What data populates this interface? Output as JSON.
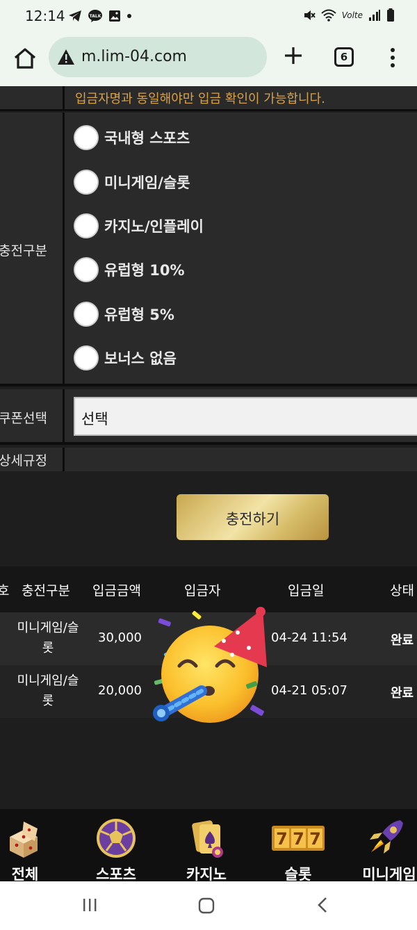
{
  "status_bar": {
    "time": "12:14",
    "notification_icons": [
      "telegram-icon",
      "kakaotalk-icon",
      "gallery-icon",
      "dot-icon"
    ],
    "system_icons": [
      "mute-icon",
      "wifi-icon",
      "volte-icon",
      "signal-icon",
      "battery-icon"
    ],
    "volte_text": "Volte"
  },
  "browser": {
    "url": "m.lim-04.com",
    "tab_count": "6"
  },
  "form": {
    "notice_text": "입금자명과 동일해야만 입금 확인이 가능합니다.",
    "charge_type_label": "충전구분",
    "charge_options": [
      "국내형 스포츠",
      "미니게임/슬롯",
      "카지노/인플레이",
      "유럽형 10%",
      "유럽형 5%",
      "보너스 없음"
    ],
    "coupon_label": "쿠폰선택",
    "coupon_value": "선택",
    "rules_label": "상세규정",
    "submit_label": "충전하기"
  },
  "history_table": {
    "columns": [
      "호",
      "충전구분",
      "입금금액",
      "입금자",
      "입금일",
      "상태"
    ],
    "rows": [
      {
        "type": "미니게임/슬롯",
        "amount": "30,000",
        "depositor": "",
        "date": "04-24 11:54",
        "status": "완료"
      },
      {
        "type": "미니게임/슬롯",
        "amount": "20,000",
        "depositor": "",
        "date": "04-21 05:07",
        "status": "완료"
      }
    ]
  },
  "overlay": {
    "emoji": "party-face-emoji"
  },
  "bottom_nav": {
    "items": [
      {
        "label": "전체",
        "icon": "dice-icon"
      },
      {
        "label": "스포츠",
        "icon": "soccer-ball-icon"
      },
      {
        "label": "카지노",
        "icon": "cards-icon"
      },
      {
        "label": "슬롯",
        "icon": "slot-777-icon"
      },
      {
        "label": "미니게임",
        "icon": "rocket-icon"
      }
    ]
  },
  "colors": {
    "accent_gold": "#d9a24a",
    "background": "#1e1e1e",
    "panel": "#2a2a2a",
    "browser_bar": "#eef6ef"
  }
}
